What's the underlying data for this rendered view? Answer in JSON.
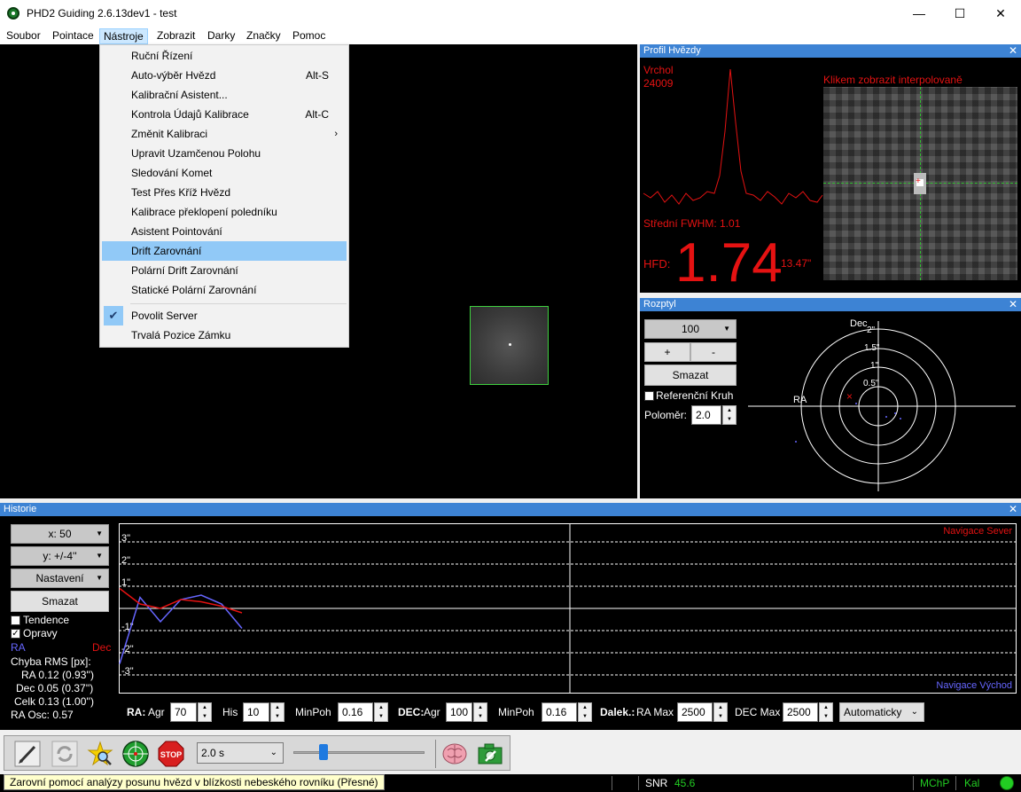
{
  "window": {
    "title": "PHD2 Guiding 2.6.13dev1 - test",
    "minimize": "—",
    "maximize": "☐",
    "close": "✕"
  },
  "menubar": [
    "Soubor",
    "Pointace",
    "Nástroje",
    "Zobrazit",
    "Darky",
    "Značky",
    "Pomoc"
  ],
  "tools_menu": {
    "items": [
      {
        "label": "Ruční Řízení",
        "shortcut": ""
      },
      {
        "label": "Auto-výběr Hvězd",
        "shortcut": "Alt-S"
      },
      {
        "label": "Kalibrační Asistent...",
        "shortcut": ""
      },
      {
        "label": "Kontrola Údajů Kalibrace",
        "shortcut": "Alt-C"
      },
      {
        "label": "Změnit Kalibraci",
        "shortcut": ""
      },
      {
        "label": "Upravit Uzamčenou Polohu",
        "shortcut": ""
      },
      {
        "label": "Sledování  Komet",
        "shortcut": ""
      },
      {
        "label": "Test Přes Kříž Hvězd",
        "shortcut": ""
      },
      {
        "label": "Kalibrace překlopení poledníku",
        "shortcut": ""
      },
      {
        "label": "Asistent Pointování",
        "shortcut": ""
      },
      {
        "label": "Drift Zarovnání",
        "shortcut": ""
      },
      {
        "label": "Polární Drift Zarovnání",
        "shortcut": ""
      },
      {
        "label": "Statické Polární Zarovnání",
        "shortcut": ""
      },
      {
        "label": "Povolit Server",
        "shortcut": ""
      },
      {
        "label": "Trvalá Pozice Zámku",
        "shortcut": ""
      }
    ],
    "submenu_arrow": "›",
    "check_mark": "✔"
  },
  "profile": {
    "title": "Profil Hvězdy",
    "peak_label": "Vrchol",
    "peak_value": "24009",
    "interp_hint": "Klikem zobrazit interpolovaně",
    "fwhm": "Střední FWHM: 1.01",
    "hfd_label": "HFD:",
    "hfd_value": "1.74",
    "hfd_arcsec": "13.47\""
  },
  "scatter": {
    "title": "Rozptyl",
    "scale_value": "100",
    "plus": "+",
    "minus": "-",
    "clear": "Smazat",
    "ref_circle": "Referenční Kruh",
    "radius_label": "Poloměr:",
    "radius_value": "2.0",
    "axis_dec": "Dec",
    "axis_ra": "RA",
    "rings": [
      "2\"",
      "1.5\"",
      "1\"",
      "0.5\""
    ]
  },
  "history": {
    "title": "Historie",
    "x_select": "x:  50",
    "y_select": "y: +/-4''",
    "settings": "Nastavení",
    "clear": "Smazat",
    "trend": "Tendence",
    "corrections": "Opravy",
    "ra_label": "RA",
    "dec_label": "Dec",
    "rms_title": "Chyba RMS [px]:",
    "rms_ra": "RA  0.12 (0.93'')",
    "rms_dec": "Dec  0.05 (0.37'')",
    "rms_total": "Celk  0.13 (1.00'')",
    "ra_osc": "RA Osc: 0.57",
    "north_label": "Navigace Sever",
    "east_label": "Navigace Východ",
    "y_ticks": [
      "3\"",
      "2\"",
      "1\"",
      "-1\"",
      "-2\"",
      "-3\""
    ],
    "ra_line": [
      -2.5,
      0.5,
      -0.6,
      0.4,
      0.6,
      0.2,
      -0.9
    ],
    "dec_line": [
      0.9,
      0.2,
      0.0,
      0.4,
      0.3,
      0.1,
      -0.2
    ]
  },
  "params": {
    "ra_label": "RA:",
    "agr_label": "Agr",
    "ra_agr": "70",
    "his_label": "His",
    "ra_his": "10",
    "minpoh_label": "MinPoh",
    "ra_minpoh": "0.16",
    "dec_label": "DEC:",
    "dec_agr": "100",
    "dec_minpoh": "0.16",
    "dalek_label": "Dalek.:",
    "ra_max_label": "RA Max",
    "ra_max": "2500",
    "dec_max_label": "DEC Max",
    "dec_max": "2500",
    "mode": "Automaticky"
  },
  "toolbar": {
    "exposure": "2.0 s",
    "stop": "STOP"
  },
  "status": {
    "message": "Zarovní pomocí analýzy posunu hvězd v blízkosti nebeského rovníku (Přesné)",
    "snr_label": "SNR",
    "snr_value": "45.6",
    "mchp": "MChP",
    "kal": "Kal"
  },
  "colors": {
    "ra": "#6666ff",
    "dec": "#e51212",
    "accent": "#3d83d4",
    "status_ok": "#22cc22"
  }
}
